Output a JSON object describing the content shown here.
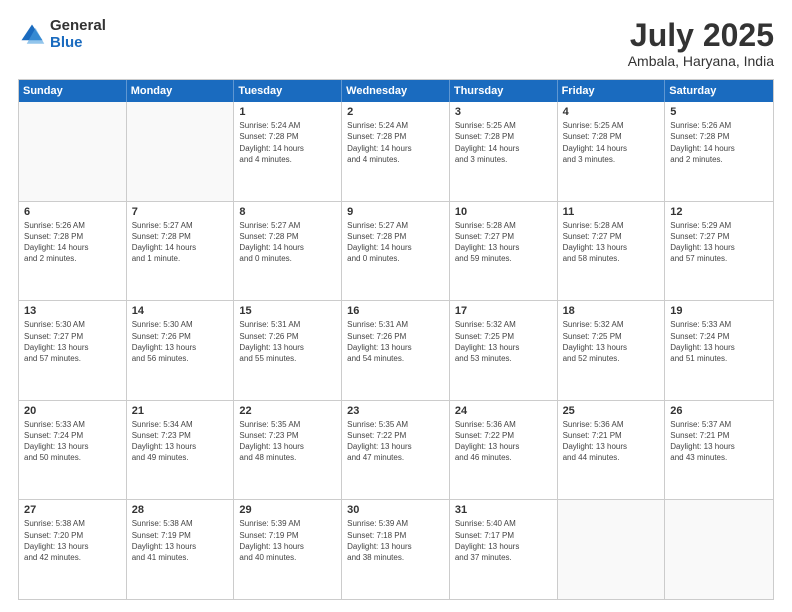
{
  "logo": {
    "general": "General",
    "blue": "Blue"
  },
  "title": "July 2025",
  "location": "Ambala, Haryana, India",
  "days": [
    "Sunday",
    "Monday",
    "Tuesday",
    "Wednesday",
    "Thursday",
    "Friday",
    "Saturday"
  ],
  "weeks": [
    [
      {
        "day": "",
        "empty": true
      },
      {
        "day": "",
        "empty": true
      },
      {
        "day": "1",
        "line1": "Sunrise: 5:24 AM",
        "line2": "Sunset: 7:28 PM",
        "line3": "Daylight: 14 hours",
        "line4": "and 4 minutes."
      },
      {
        "day": "2",
        "line1": "Sunrise: 5:24 AM",
        "line2": "Sunset: 7:28 PM",
        "line3": "Daylight: 14 hours",
        "line4": "and 4 minutes."
      },
      {
        "day": "3",
        "line1": "Sunrise: 5:25 AM",
        "line2": "Sunset: 7:28 PM",
        "line3": "Daylight: 14 hours",
        "line4": "and 3 minutes."
      },
      {
        "day": "4",
        "line1": "Sunrise: 5:25 AM",
        "line2": "Sunset: 7:28 PM",
        "line3": "Daylight: 14 hours",
        "line4": "and 3 minutes."
      },
      {
        "day": "5",
        "line1": "Sunrise: 5:26 AM",
        "line2": "Sunset: 7:28 PM",
        "line3": "Daylight: 14 hours",
        "line4": "and 2 minutes."
      }
    ],
    [
      {
        "day": "6",
        "line1": "Sunrise: 5:26 AM",
        "line2": "Sunset: 7:28 PM",
        "line3": "Daylight: 14 hours",
        "line4": "and 2 minutes."
      },
      {
        "day": "7",
        "line1": "Sunrise: 5:27 AM",
        "line2": "Sunset: 7:28 PM",
        "line3": "Daylight: 14 hours",
        "line4": "and 1 minute."
      },
      {
        "day": "8",
        "line1": "Sunrise: 5:27 AM",
        "line2": "Sunset: 7:28 PM",
        "line3": "Daylight: 14 hours",
        "line4": "and 0 minutes."
      },
      {
        "day": "9",
        "line1": "Sunrise: 5:27 AM",
        "line2": "Sunset: 7:28 PM",
        "line3": "Daylight: 14 hours",
        "line4": "and 0 minutes."
      },
      {
        "day": "10",
        "line1": "Sunrise: 5:28 AM",
        "line2": "Sunset: 7:27 PM",
        "line3": "Daylight: 13 hours",
        "line4": "and 59 minutes."
      },
      {
        "day": "11",
        "line1": "Sunrise: 5:28 AM",
        "line2": "Sunset: 7:27 PM",
        "line3": "Daylight: 13 hours",
        "line4": "and 58 minutes."
      },
      {
        "day": "12",
        "line1": "Sunrise: 5:29 AM",
        "line2": "Sunset: 7:27 PM",
        "line3": "Daylight: 13 hours",
        "line4": "and 57 minutes."
      }
    ],
    [
      {
        "day": "13",
        "line1": "Sunrise: 5:30 AM",
        "line2": "Sunset: 7:27 PM",
        "line3": "Daylight: 13 hours",
        "line4": "and 57 minutes."
      },
      {
        "day": "14",
        "line1": "Sunrise: 5:30 AM",
        "line2": "Sunset: 7:26 PM",
        "line3": "Daylight: 13 hours",
        "line4": "and 56 minutes."
      },
      {
        "day": "15",
        "line1": "Sunrise: 5:31 AM",
        "line2": "Sunset: 7:26 PM",
        "line3": "Daylight: 13 hours",
        "line4": "and 55 minutes."
      },
      {
        "day": "16",
        "line1": "Sunrise: 5:31 AM",
        "line2": "Sunset: 7:26 PM",
        "line3": "Daylight: 13 hours",
        "line4": "and 54 minutes."
      },
      {
        "day": "17",
        "line1": "Sunrise: 5:32 AM",
        "line2": "Sunset: 7:25 PM",
        "line3": "Daylight: 13 hours",
        "line4": "and 53 minutes."
      },
      {
        "day": "18",
        "line1": "Sunrise: 5:32 AM",
        "line2": "Sunset: 7:25 PM",
        "line3": "Daylight: 13 hours",
        "line4": "and 52 minutes."
      },
      {
        "day": "19",
        "line1": "Sunrise: 5:33 AM",
        "line2": "Sunset: 7:24 PM",
        "line3": "Daylight: 13 hours",
        "line4": "and 51 minutes."
      }
    ],
    [
      {
        "day": "20",
        "line1": "Sunrise: 5:33 AM",
        "line2": "Sunset: 7:24 PM",
        "line3": "Daylight: 13 hours",
        "line4": "and 50 minutes."
      },
      {
        "day": "21",
        "line1": "Sunrise: 5:34 AM",
        "line2": "Sunset: 7:23 PM",
        "line3": "Daylight: 13 hours",
        "line4": "and 49 minutes."
      },
      {
        "day": "22",
        "line1": "Sunrise: 5:35 AM",
        "line2": "Sunset: 7:23 PM",
        "line3": "Daylight: 13 hours",
        "line4": "and 48 minutes."
      },
      {
        "day": "23",
        "line1": "Sunrise: 5:35 AM",
        "line2": "Sunset: 7:22 PM",
        "line3": "Daylight: 13 hours",
        "line4": "and 47 minutes."
      },
      {
        "day": "24",
        "line1": "Sunrise: 5:36 AM",
        "line2": "Sunset: 7:22 PM",
        "line3": "Daylight: 13 hours",
        "line4": "and 46 minutes."
      },
      {
        "day": "25",
        "line1": "Sunrise: 5:36 AM",
        "line2": "Sunset: 7:21 PM",
        "line3": "Daylight: 13 hours",
        "line4": "and 44 minutes."
      },
      {
        "day": "26",
        "line1": "Sunrise: 5:37 AM",
        "line2": "Sunset: 7:21 PM",
        "line3": "Daylight: 13 hours",
        "line4": "and 43 minutes."
      }
    ],
    [
      {
        "day": "27",
        "line1": "Sunrise: 5:38 AM",
        "line2": "Sunset: 7:20 PM",
        "line3": "Daylight: 13 hours",
        "line4": "and 42 minutes."
      },
      {
        "day": "28",
        "line1": "Sunrise: 5:38 AM",
        "line2": "Sunset: 7:19 PM",
        "line3": "Daylight: 13 hours",
        "line4": "and 41 minutes."
      },
      {
        "day": "29",
        "line1": "Sunrise: 5:39 AM",
        "line2": "Sunset: 7:19 PM",
        "line3": "Daylight: 13 hours",
        "line4": "and 40 minutes."
      },
      {
        "day": "30",
        "line1": "Sunrise: 5:39 AM",
        "line2": "Sunset: 7:18 PM",
        "line3": "Daylight: 13 hours",
        "line4": "and 38 minutes."
      },
      {
        "day": "31",
        "line1": "Sunrise: 5:40 AM",
        "line2": "Sunset: 7:17 PM",
        "line3": "Daylight: 13 hours",
        "line4": "and 37 minutes."
      },
      {
        "day": "",
        "empty": true
      },
      {
        "day": "",
        "empty": true
      }
    ]
  ]
}
